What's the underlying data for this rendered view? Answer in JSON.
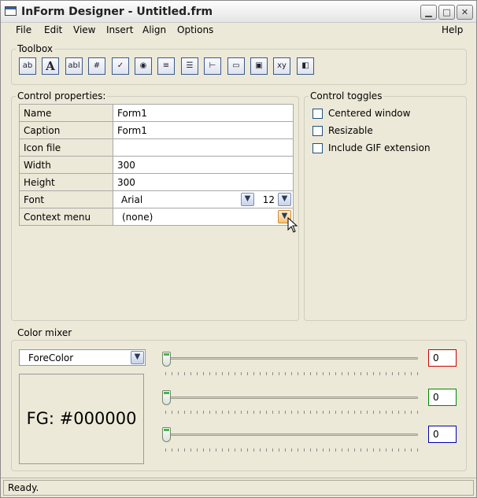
{
  "window": {
    "title": "InForm Designer - Untitled.frm"
  },
  "menu": {
    "items": [
      "File",
      "Edit",
      "View",
      "Insert",
      "Align",
      "Options"
    ],
    "help": "Help"
  },
  "toolbox": {
    "label": "Toolbox",
    "tools": [
      {
        "icon": "button-tool-icon",
        "glyph": "ab"
      },
      {
        "icon": "label-tool-icon",
        "glyph": "A"
      },
      {
        "icon": "textbox-tool-icon",
        "glyph": "abl"
      },
      {
        "icon": "frame-tool-icon",
        "glyph": "#"
      },
      {
        "icon": "checkbox-tool-icon",
        "glyph": "✓"
      },
      {
        "icon": "radio-tool-icon",
        "glyph": "◉"
      },
      {
        "icon": "combobox-tool-icon",
        "glyph": "≡"
      },
      {
        "icon": "listbox-tool-icon",
        "glyph": "☰"
      },
      {
        "icon": "slider-tool-icon",
        "glyph": "⊢"
      },
      {
        "icon": "progressbar-tool-icon",
        "glyph": "▭"
      },
      {
        "icon": "image-tool-icon",
        "glyph": "▣"
      },
      {
        "icon": "groupbox-tool-icon",
        "glyph": "xy"
      },
      {
        "icon": "toggle-tool-icon",
        "glyph": "◧"
      }
    ]
  },
  "properties": {
    "label": "Control properties:",
    "rows": [
      {
        "label": "Name",
        "value": "Form1"
      },
      {
        "label": "Caption",
        "value": "Form1"
      },
      {
        "label": "Icon file",
        "value": ""
      },
      {
        "label": "Width",
        "value": "300"
      },
      {
        "label": "Height",
        "value": "300"
      }
    ],
    "font": {
      "label": "Font",
      "family": "Arial",
      "size": "12"
    },
    "context_menu": {
      "label": "Context menu",
      "value": "(none)"
    }
  },
  "toggles": {
    "label": "Control toggles",
    "items": [
      {
        "label": "Centered window",
        "checked": false
      },
      {
        "label": "Resizable",
        "checked": false
      },
      {
        "label": "Include GIF extension",
        "checked": false
      }
    ]
  },
  "color_mixer": {
    "label": "Color mixer",
    "selected": "ForeColor",
    "preview": "FG: #000000",
    "channels": [
      {
        "value": "0",
        "level": 0,
        "color": "#cc0000"
      },
      {
        "value": "0",
        "level": 0,
        "color": "#008800"
      },
      {
        "value": "0",
        "level": 0,
        "color": "#0000aa"
      }
    ]
  },
  "status": "Ready."
}
